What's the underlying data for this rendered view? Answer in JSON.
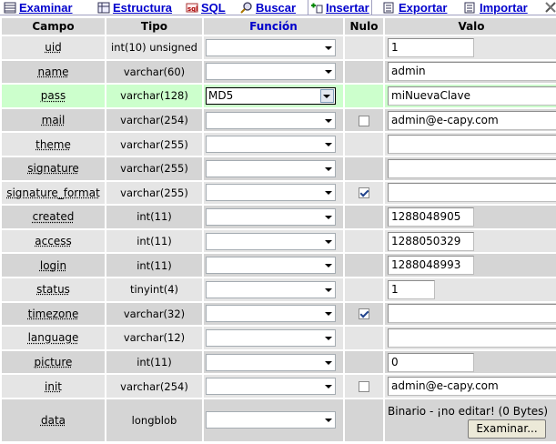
{
  "tabs": [
    {
      "label": "Examinar",
      "icon": "browse-table-icon",
      "active": false
    },
    {
      "label": "Estructura",
      "icon": "structure-icon",
      "active": false
    },
    {
      "label": "SQL",
      "icon": "sql-icon",
      "active": false
    },
    {
      "label": "Buscar",
      "icon": "search-icon",
      "active": false
    },
    {
      "label": "Insertar",
      "icon": "insert-icon",
      "active": true
    },
    {
      "label": "Exportar",
      "icon": "export-icon",
      "active": false
    },
    {
      "label": "Importar",
      "icon": "import-icon",
      "active": false
    }
  ],
  "headers": {
    "field": "Campo",
    "type": "Tipo",
    "function": "Función",
    "null": "Nulo",
    "value": "Valo"
  },
  "rows": [
    {
      "field": "uid",
      "type": "int(10) unsigned",
      "function": "",
      "null": null,
      "value": "1",
      "width": "med"
    },
    {
      "field": "name",
      "type": "varchar(60)",
      "function": "",
      "null": null,
      "value": "admin",
      "width": "long"
    },
    {
      "field": "pass",
      "type": "varchar(128)",
      "function": "MD5",
      "null": null,
      "value": "miNuevaClave",
      "width": "long",
      "highlight": true
    },
    {
      "field": "mail",
      "type": "varchar(254)",
      "function": "",
      "null": false,
      "value": "admin@e-capy.com",
      "width": "long"
    },
    {
      "field": "theme",
      "type": "varchar(255)",
      "function": "",
      "null": null,
      "value": "",
      "width": "long"
    },
    {
      "field": "signature",
      "type": "varchar(255)",
      "function": "",
      "null": null,
      "value": "",
      "width": "long"
    },
    {
      "field": "signature_format",
      "type": "varchar(255)",
      "function": "",
      "null": true,
      "value": "",
      "width": "long"
    },
    {
      "field": "created",
      "type": "int(11)",
      "function": "",
      "null": null,
      "value": "1288048905",
      "width": "med"
    },
    {
      "field": "access",
      "type": "int(11)",
      "function": "",
      "null": null,
      "value": "1288050329",
      "width": "med"
    },
    {
      "field": "login",
      "type": "int(11)",
      "function": "",
      "null": null,
      "value": "1288048993",
      "width": "med"
    },
    {
      "field": "status",
      "type": "tinyint(4)",
      "function": "",
      "null": null,
      "value": "1",
      "width": "short"
    },
    {
      "field": "timezone",
      "type": "varchar(32)",
      "function": "",
      "null": true,
      "value": "",
      "width": "long"
    },
    {
      "field": "language",
      "type": "varchar(12)",
      "function": "",
      "null": null,
      "value": "",
      "width": "long"
    },
    {
      "field": "picture",
      "type": "int(11)",
      "function": "",
      "null": null,
      "value": "0",
      "width": "med"
    },
    {
      "field": "init",
      "type": "varchar(254)",
      "function": "",
      "null": false,
      "value": "admin@e-capy.com",
      "width": "long"
    },
    {
      "field": "data",
      "type": "longblob",
      "function": "",
      "null": null,
      "binary": true
    }
  ],
  "binary_note": "Binario - ¡no editar! (0 Bytes)",
  "browse_label": "Examinar..."
}
